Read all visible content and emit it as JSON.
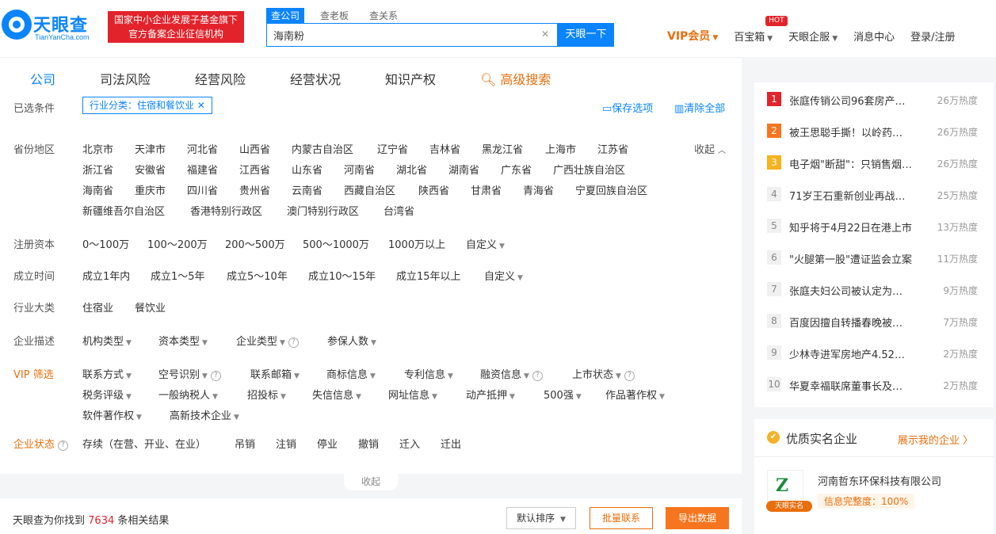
{
  "header": {
    "logo_text": "天眼查",
    "logo_sub": "TianYanCha.com",
    "badge_line1": "国家中小企业发展子基金旗下",
    "badge_line2": "官方备案企业征信机构",
    "search_tabs": [
      "查公司",
      "查老板",
      "查关系"
    ],
    "search_value": "海南粉",
    "search_button": "天眼一下",
    "nav": {
      "vip": "VIP会员",
      "baibaoxiang": "百宝箱",
      "hot": "HOT",
      "qifu": "天眼企服",
      "messages": "消息中心",
      "login": "登录/注册"
    }
  },
  "tabs": [
    "公司",
    "司法风险",
    "经营风险",
    "经营状况",
    "知识产权",
    "高级搜索"
  ],
  "filters": {
    "selected_label": "已选条件",
    "selected_chip": "行业分类：住宿和餐饮业",
    "save": "保存选项",
    "clear": "清除全部",
    "province_label": "省份地区",
    "collapse": "收起",
    "provinces": [
      [
        "北京市",
        "天津市",
        "河北省",
        "山西省",
        "内蒙古自治区",
        "辽宁省",
        "吉林省",
        "黑龙江省",
        "上海市",
        "江苏省"
      ],
      [
        "浙江省",
        "安徽省",
        "福建省",
        "江西省",
        "山东省",
        "河南省",
        "湖北省",
        "湖南省",
        "广东省",
        "广西壮族自治区"
      ],
      [
        "海南省",
        "重庆市",
        "四川省",
        "贵州省",
        "云南省",
        "西藏自治区",
        "陕西省",
        "甘肃省",
        "青海省",
        "宁夏回族自治区"
      ],
      [
        "新疆维吾尔自治区",
        "香港特别行政区",
        "澳门特别行政区",
        "台湾省"
      ]
    ],
    "capital_label": "注册资本",
    "capital": [
      "0～100万",
      "100～200万",
      "200～500万",
      "500～1000万",
      "1000万以上",
      "自定义"
    ],
    "founded_label": "成立时间",
    "founded": [
      "成立1年内",
      "成立1～5年",
      "成立5～10年",
      "成立10～15年",
      "成立15年以上",
      "自定义"
    ],
    "industry_label": "行业大类",
    "industry": [
      "住宿业",
      "餐饮业"
    ],
    "desc_label": "企业描述",
    "desc": [
      "机构类型",
      "资本类型",
      "企业类型",
      "参保人数"
    ],
    "vip_label": "VIP 筛选",
    "vip_row1": [
      "联系方式",
      "空号识别",
      "联系邮箱",
      "商标信息",
      "专利信息",
      "融资信息",
      "上市状态"
    ],
    "vip_row2": [
      "税务评级",
      "一般纳税人",
      "招投标",
      "失信信息",
      "网址信息",
      "动产抵押",
      "500强",
      "作品著作权"
    ],
    "vip_row3": [
      "软件著作权",
      "高新技术企业"
    ],
    "status_label": "企业状态",
    "status": [
      "存续（在营、开业、在业）",
      "吊销",
      "注销",
      "停业",
      "撤销",
      "迁入",
      "迁出"
    ],
    "collapse_tab": "收起"
  },
  "result": {
    "prefix": "天眼查为你找到",
    "count": "7634",
    "suffix": "条相关结果",
    "sort": "默认排序",
    "batch_contact": "批量联系",
    "export": "导出数据"
  },
  "hotlist": [
    {
      "rank": "1",
      "title": "张庭传销公司96套房产…",
      "heat": "26万热度"
    },
    {
      "rank": "2",
      "title": "被王思聪手撕！以岭药…",
      "heat": "26万热度"
    },
    {
      "rank": "3",
      "title": "电子烟\"断甜\"：只销售烟…",
      "heat": "26万热度"
    },
    {
      "rank": "4",
      "title": "71岁王石重新创业再战…",
      "heat": "25万热度"
    },
    {
      "rank": "5",
      "title": "知乎将于4月22日在港上市",
      "heat": "13万热度"
    },
    {
      "rank": "6",
      "title": "\"火腿第一股\"遭证监会立案",
      "heat": "11万热度"
    },
    {
      "rank": "7",
      "title": "张庭夫妇公司被认定为…",
      "heat": "9万热度"
    },
    {
      "rank": "8",
      "title": "百度因擅自转播春晚被…",
      "heat": "7万热度"
    },
    {
      "rank": "9",
      "title": "少林寺进军房地产4.52…",
      "heat": "2万热度"
    },
    {
      "rank": "10",
      "title": "华夏幸福联席董事长及…",
      "heat": "2万热度"
    }
  ],
  "quality": {
    "title": "优质实名企业",
    "link": "展示我的企业 〉",
    "logo_tag": "天眼实名",
    "company": "河南哲东环保科技有限公司",
    "score": "信息完整度：100%"
  }
}
